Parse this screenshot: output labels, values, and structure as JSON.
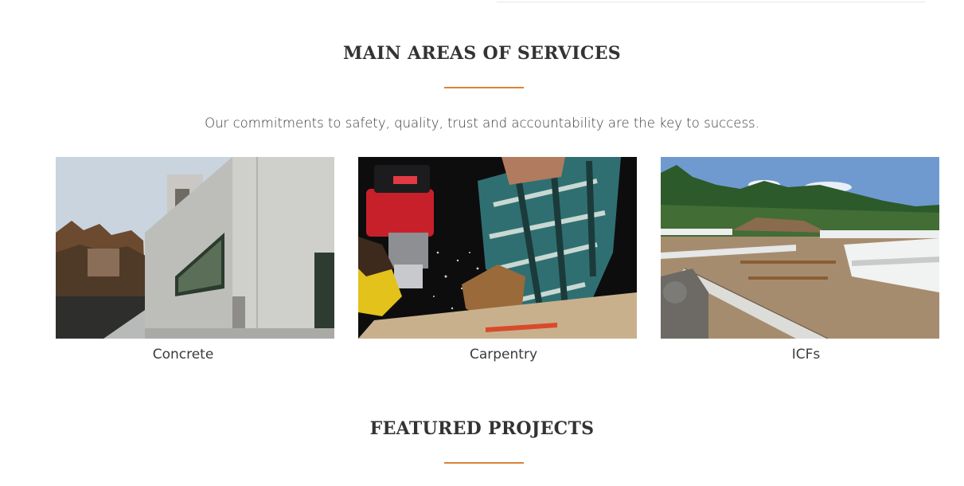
{
  "colors": {
    "accent": "#d9833a",
    "heading": "#333333",
    "text": "#3a3a3a"
  },
  "services": {
    "title": "MAIN AREAS OF SERVICES",
    "tagline": "Our commitments to safety, quality, trust and accountability are the key to success.",
    "items": [
      {
        "label": "Concrete",
        "image": "concrete-building-photo"
      },
      {
        "label": "Carpentry",
        "image": "carpentry-router-photo"
      },
      {
        "label": "ICFs",
        "image": "icf-foundation-site-photo"
      }
    ]
  },
  "projects": {
    "title": "FEATURED PROJECTS"
  }
}
